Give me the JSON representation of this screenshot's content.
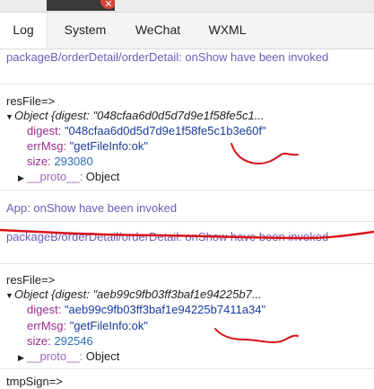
{
  "tabs": [
    "Log",
    "System",
    "WeChat",
    "WXML"
  ],
  "active_tab": "Log",
  "entries": {
    "page_show_top": "packageB/orderDetail/orderDetail: onShow have been invoked",
    "resfile_1": {
      "label": "resFile=>",
      "summary": "Object {digest: \"048cfaa6d0d5d7d9e1f58fe5c1...",
      "digest_key": "digest:",
      "digest_val": "\"048cfaa6d0d5d7d9e1f58fe5c1b3e60f\"",
      "errmsg_key": "errMsg:",
      "errmsg_val": "\"getFileInfo:ok\"",
      "size_key": "size:",
      "size_val": "293080",
      "proto_key": "__proto__:",
      "proto_val": "Object"
    },
    "app_show": "App: onShow have been invoked",
    "page_show_mid": "packageB/orderDetail/orderDetail: onShow have been invoked",
    "resfile_2": {
      "label": "resFile=>",
      "summary": "Object {digest: \"aeb99c9fb03ff3baf1e94225b7...",
      "digest_key": "digest:",
      "digest_val": "\"aeb99c9fb03ff3baf1e94225b7411a34\"",
      "errmsg_key": "errMsg:",
      "errmsg_val": "\"getFileInfo:ok\"",
      "size_key": "size:",
      "size_val": "292546",
      "proto_key": "__proto__:",
      "proto_val": "Object"
    },
    "tmp_sign": "tmpSign=>"
  },
  "colors": {
    "annotation": "#d8141a",
    "log_purple": "#6b5bb8"
  }
}
